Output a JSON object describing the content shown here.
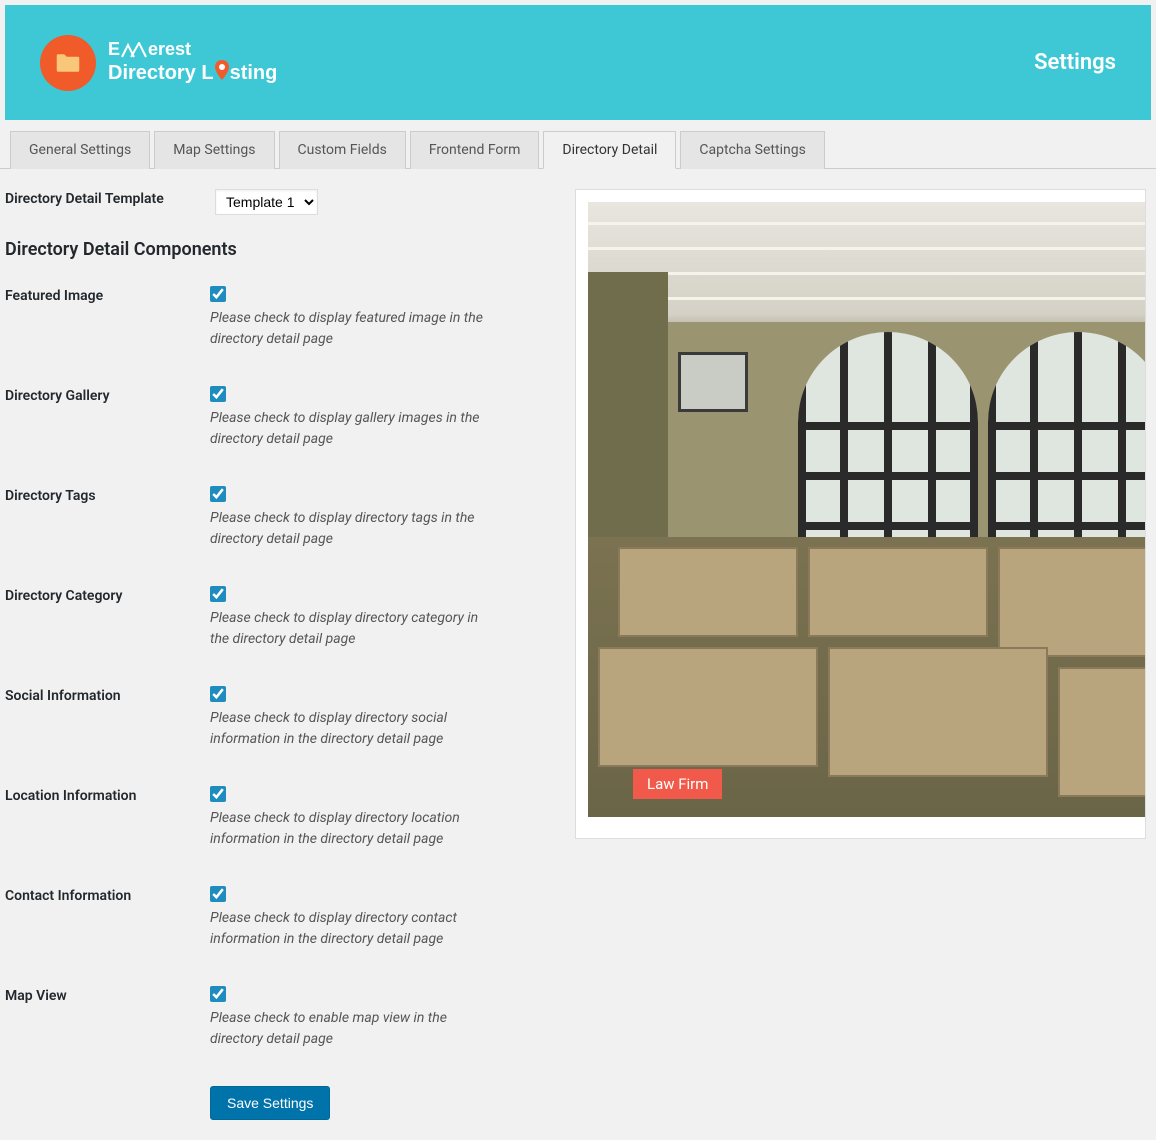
{
  "brand": {
    "line1_pre": "E",
    "line1_post": "erest",
    "line2_pre": "Directory L",
    "line2_post": "sting"
  },
  "header": {
    "settings_label": "Settings"
  },
  "tabs": [
    {
      "label": "General Settings",
      "active": false
    },
    {
      "label": "Map Settings",
      "active": false
    },
    {
      "label": "Custom Fields",
      "active": false
    },
    {
      "label": "Frontend Form",
      "active": false
    },
    {
      "label": "Directory Detail",
      "active": true
    },
    {
      "label": "Captcha Settings",
      "active": false
    }
  ],
  "template_row": {
    "label": "Directory Detail Template",
    "selected": "Template 1"
  },
  "section_title": "Directory Detail Components",
  "options": [
    {
      "label": "Featured Image",
      "desc": "Please check to display featured image in the directory detail page",
      "checked": true
    },
    {
      "label": "Directory Gallery",
      "desc": "Please check to display gallery images in the directory detail page",
      "checked": true
    },
    {
      "label": "Directory Tags",
      "desc": "Please check to display directory tags in the directory detail page",
      "checked": true
    },
    {
      "label": "Directory Category",
      "desc": "Please check to display directory category in the directory detail page",
      "checked": true
    },
    {
      "label": "Social Information",
      "desc": "Please check to display directory social information in the directory detail page",
      "checked": true
    },
    {
      "label": "Location Information",
      "desc": "Please check to display directory location information in the directory detail page",
      "checked": true
    },
    {
      "label": "Contact Information",
      "desc": "Please check to display directory contact information in the directory detail page",
      "checked": true
    },
    {
      "label": "Map View",
      "desc": "Please check to enable map view in the directory detail page",
      "checked": true
    }
  ],
  "save_button_label": "Save Settings",
  "preview": {
    "badge_text": "Law Firm"
  }
}
